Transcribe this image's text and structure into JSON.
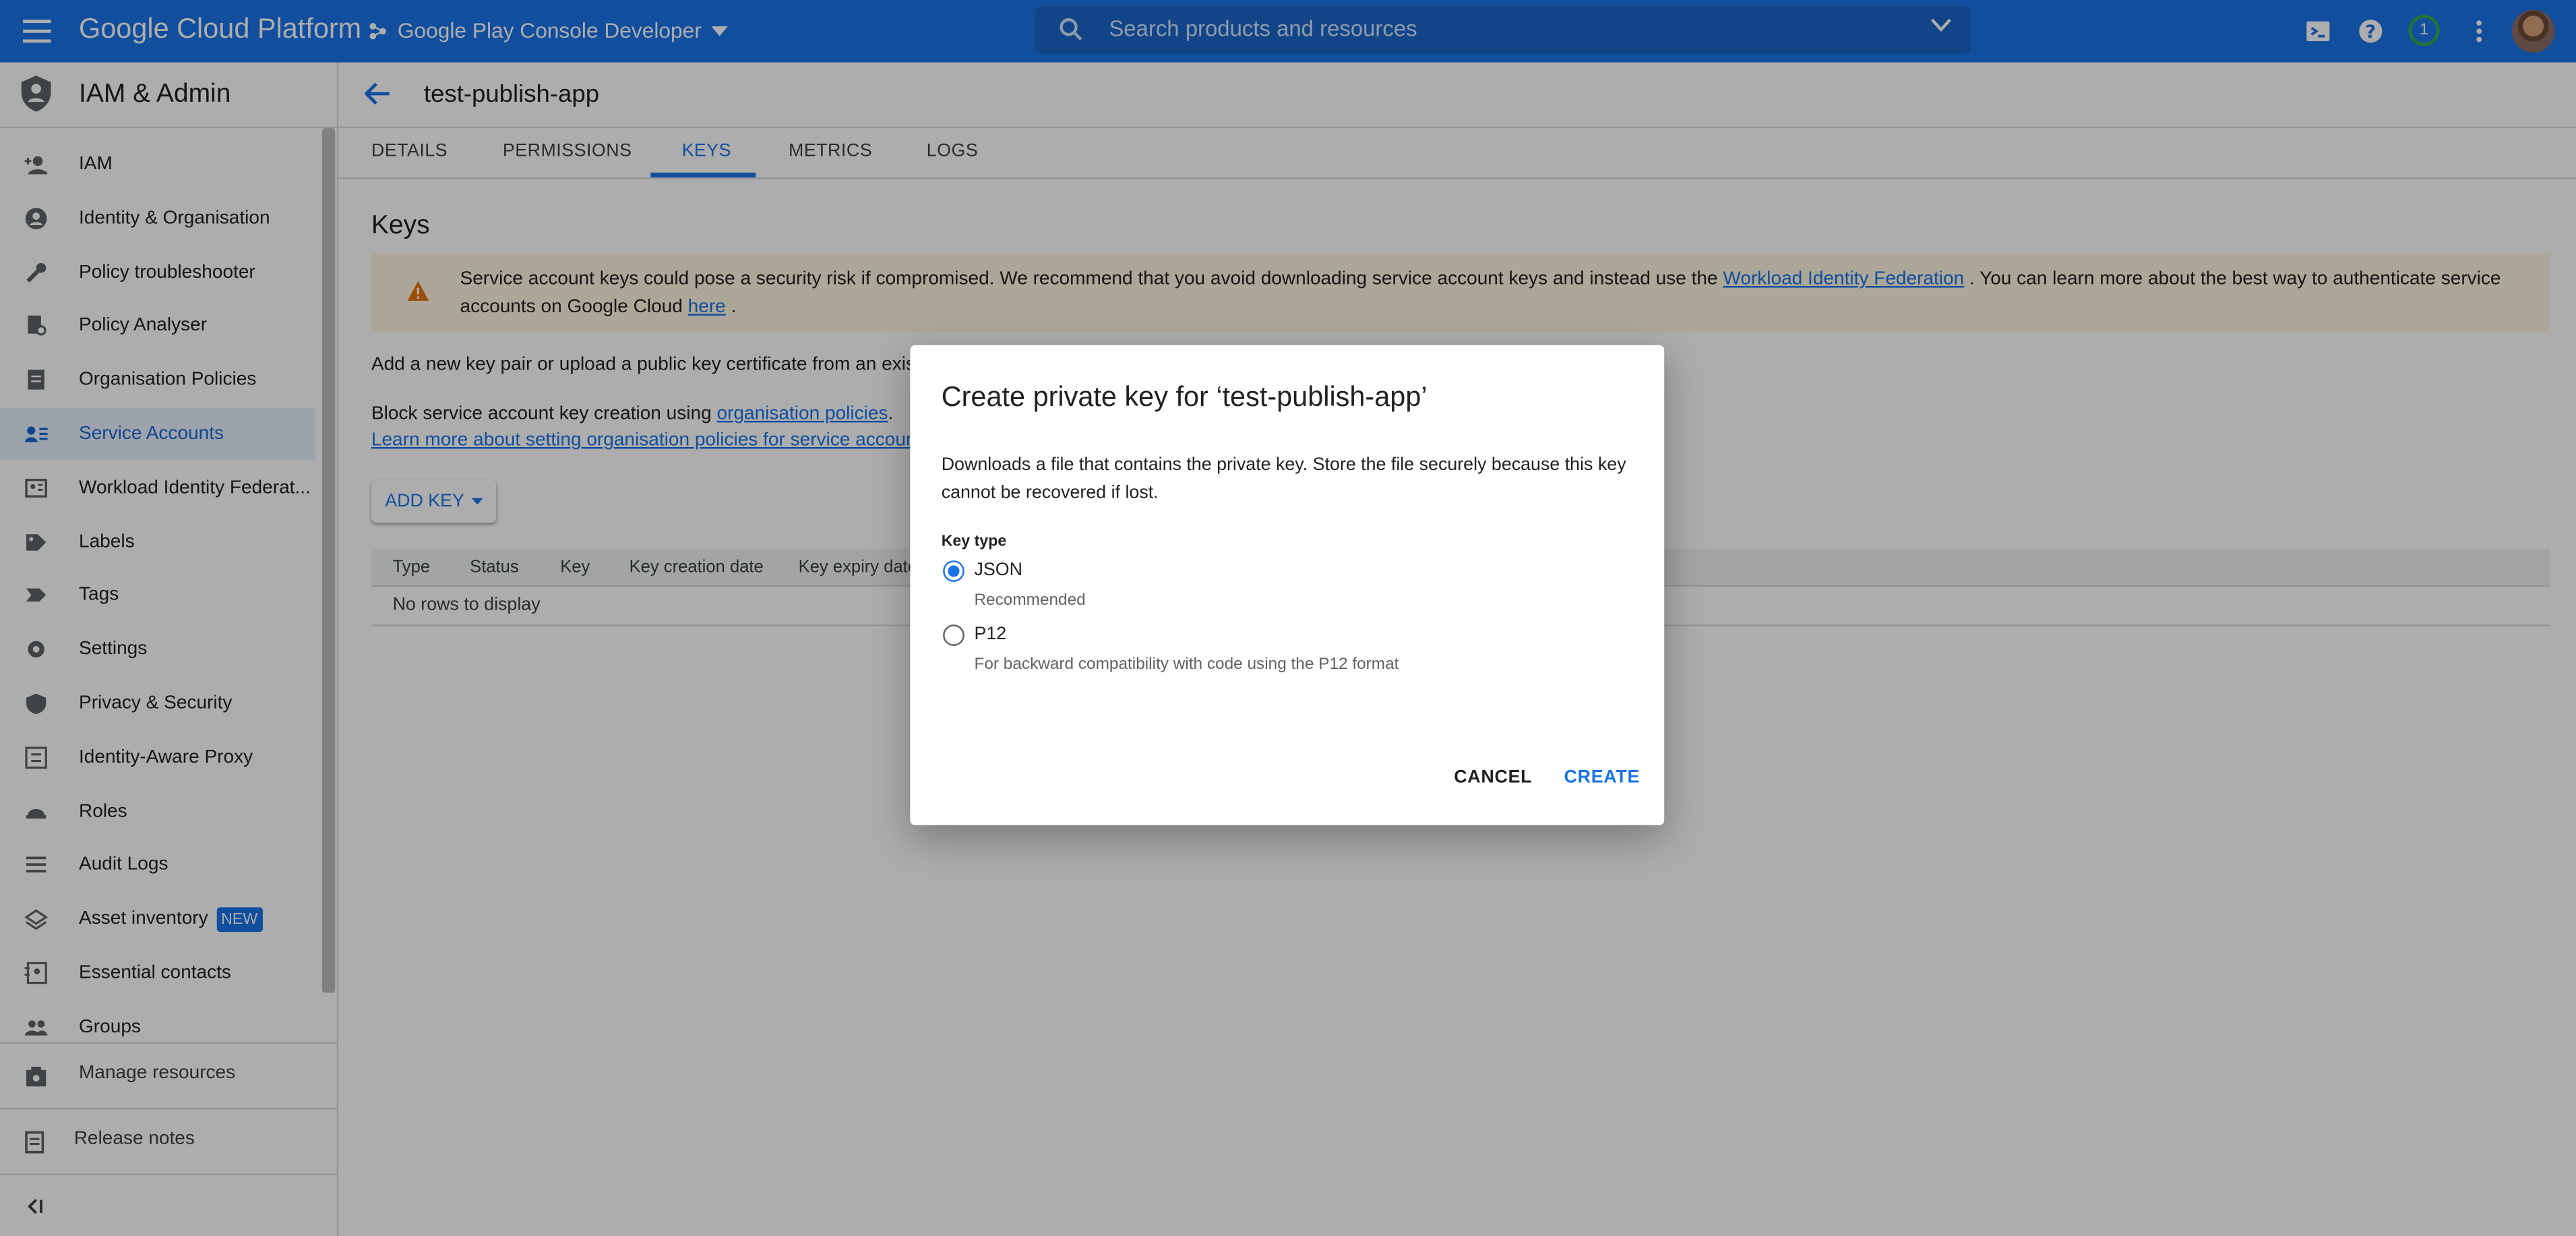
{
  "topbar": {
    "brand": "Google Cloud Platform",
    "project": "Google Play Console Developer",
    "search_placeholder": "Search products and resources",
    "notification_count": "1"
  },
  "sidebar": {
    "title": "IAM & Admin",
    "items": [
      {
        "label": "IAM",
        "icon": "add-person-icon"
      },
      {
        "label": "Identity & Organisation",
        "icon": "account-circle-icon"
      },
      {
        "label": "Policy troubleshooter",
        "icon": "wrench-icon"
      },
      {
        "label": "Policy Analyser",
        "icon": "document-search-icon"
      },
      {
        "label": "Organisation Policies",
        "icon": "document-icon"
      },
      {
        "label": "Service Accounts",
        "icon": "service-account-icon",
        "active": true
      },
      {
        "label": "Workload Identity Federat...",
        "icon": "id-card-icon"
      },
      {
        "label": "Labels",
        "icon": "label-icon"
      },
      {
        "label": "Tags",
        "icon": "tag-icon"
      },
      {
        "label": "Settings",
        "icon": "gear-icon"
      },
      {
        "label": "Privacy & Security",
        "icon": "shield-icon"
      },
      {
        "label": "Identity-Aware Proxy",
        "icon": "proxy-icon"
      },
      {
        "label": "Roles",
        "icon": "hat-icon"
      },
      {
        "label": "Audit Logs",
        "icon": "list-icon"
      },
      {
        "label": "Asset inventory",
        "icon": "layers-icon",
        "badge": "NEW"
      },
      {
        "label": "Essential contacts",
        "icon": "contacts-icon"
      },
      {
        "label": "Groups",
        "icon": "group-icon"
      }
    ],
    "manage_resources": "Manage resources",
    "release_notes": "Release notes"
  },
  "page": {
    "title": "test-publish-app",
    "tabs": [
      "DETAILS",
      "PERMISSIONS",
      "KEYS",
      "METRICS",
      "LOGS"
    ],
    "active_tab": "KEYS",
    "section_title": "Keys",
    "warning": {
      "text_before": "Service account keys could pose a security risk if compromised. We recommend that you avoid downloading service account keys and instead use the ",
      "link1": "Workload Identity Federation",
      "text_middle": " . You can learn more about the best way to authenticate service accounts on Google Cloud ",
      "link2": "here",
      "text_after": " ."
    },
    "add_key_text": "Add a new key pair or upload a public key certificate from an existing k",
    "block_text": "Block service account key creation using ",
    "block_link": "organisation policies",
    "block_text_after": ".",
    "learn_link": "Learn more about setting organisation policies for service accounts",
    "add_key_button": "ADD KEY",
    "table_headers": [
      "Type",
      "Status",
      "Key",
      "Key creation date",
      "Key expiry date"
    ],
    "empty_text": "No rows to display"
  },
  "dialog": {
    "title": "Create private key for ‘test-publish-app’",
    "body": "Downloads a file that contains the private key. Store the file securely because this key cannot be recovered if lost.",
    "key_type_label": "Key type",
    "options": [
      {
        "label": "JSON",
        "description": "Recommended",
        "selected": true
      },
      {
        "label": "P12",
        "description": "For backward compatibility with code using the P12 format",
        "selected": false
      }
    ],
    "cancel": "CANCEL",
    "create": "CREATE"
  },
  "colors": {
    "brand_blue": "#1a73e8",
    "warning_bg": "#fef7e0",
    "warning_icon": "#e37400"
  }
}
